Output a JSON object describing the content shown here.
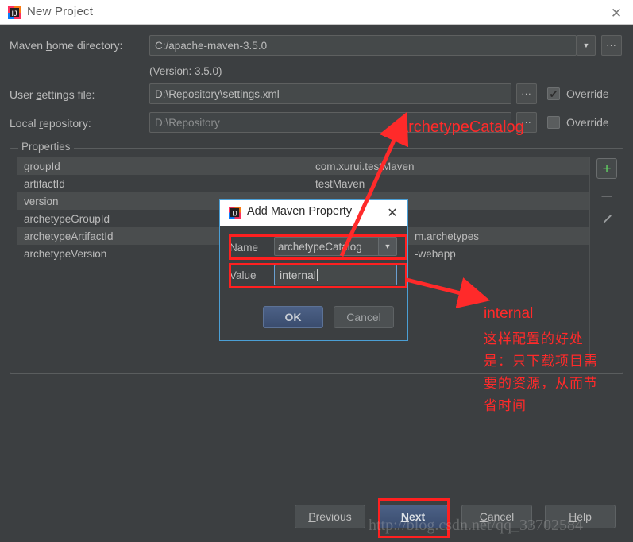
{
  "window": {
    "title": "New Project",
    "icon": "intellij-idea-logo",
    "close_label": "✕"
  },
  "form": {
    "maven_home": {
      "label_pre": "Maven ",
      "label_key": "h",
      "label_post": "ome directory:",
      "value": "C:/apache-maven-3.5.0",
      "dropdown_icon": "▼",
      "browse_label": "..."
    },
    "version_note": "(Version: 3.5.0)",
    "user_settings": {
      "label_pre": "User ",
      "label_key": "s",
      "label_post": "ettings file:",
      "value": "D:\\Repository\\settings.xml",
      "browse_label": "...",
      "override_label": "Override",
      "override_checked": true,
      "check_glyph": "✔"
    },
    "local_repo": {
      "label_pre": "Local ",
      "label_key": "r",
      "label_post": "epository:",
      "value": "D:\\Repository",
      "browse_label": "...",
      "override_label": "Override",
      "override_checked": false,
      "check_glyph": "✔"
    }
  },
  "properties": {
    "group_title": "Properties",
    "rows": [
      {
        "key": "groupId",
        "value": "com.xurui.testMaven"
      },
      {
        "key": "artifactId",
        "value": "testMaven"
      },
      {
        "key": "version",
        "value": ""
      },
      {
        "key": "archetypeGroupId",
        "value": ""
      },
      {
        "key": "archetypeArtifactId",
        "value": "m.archetypes"
      },
      {
        "key": "archetypeVersion",
        "value": "-webapp"
      }
    ],
    "tools": {
      "add_label": "+",
      "remove_label": "—",
      "edit_label": "✎"
    }
  },
  "dialog": {
    "title": "Add Maven Property",
    "icon": "intellij-idea-logo",
    "close_label": "✕",
    "name_label": "Name",
    "name_value": "archetypeCatalog",
    "name_dropdown_icon": "▼",
    "value_label": "Value",
    "value_value": "internal",
    "ok_label": "OK",
    "cancel_label": "Cancel"
  },
  "footer": {
    "previous": {
      "pre": "",
      "key": "P",
      "post": "revious"
    },
    "next": {
      "pre": "",
      "key": "N",
      "post": "ext"
    },
    "cancel": {
      "pre": "",
      "key": "C",
      "post": "ancel"
    },
    "help": {
      "pre": "",
      "key": "H",
      "post": "elp"
    },
    "watermark": "http://blog.csdn.net/qq_33702584"
  },
  "annotations": {
    "label_archetype_catalog": "archetypeCatalog",
    "label_internal": "internal",
    "cn_line1": "这样配置的好处",
    "cn_line2": "是：只下载项目需",
    "cn_line3": "要的资源，从而节",
    "cn_line4": "省时间",
    "accent_color": "#ff2a2a"
  }
}
